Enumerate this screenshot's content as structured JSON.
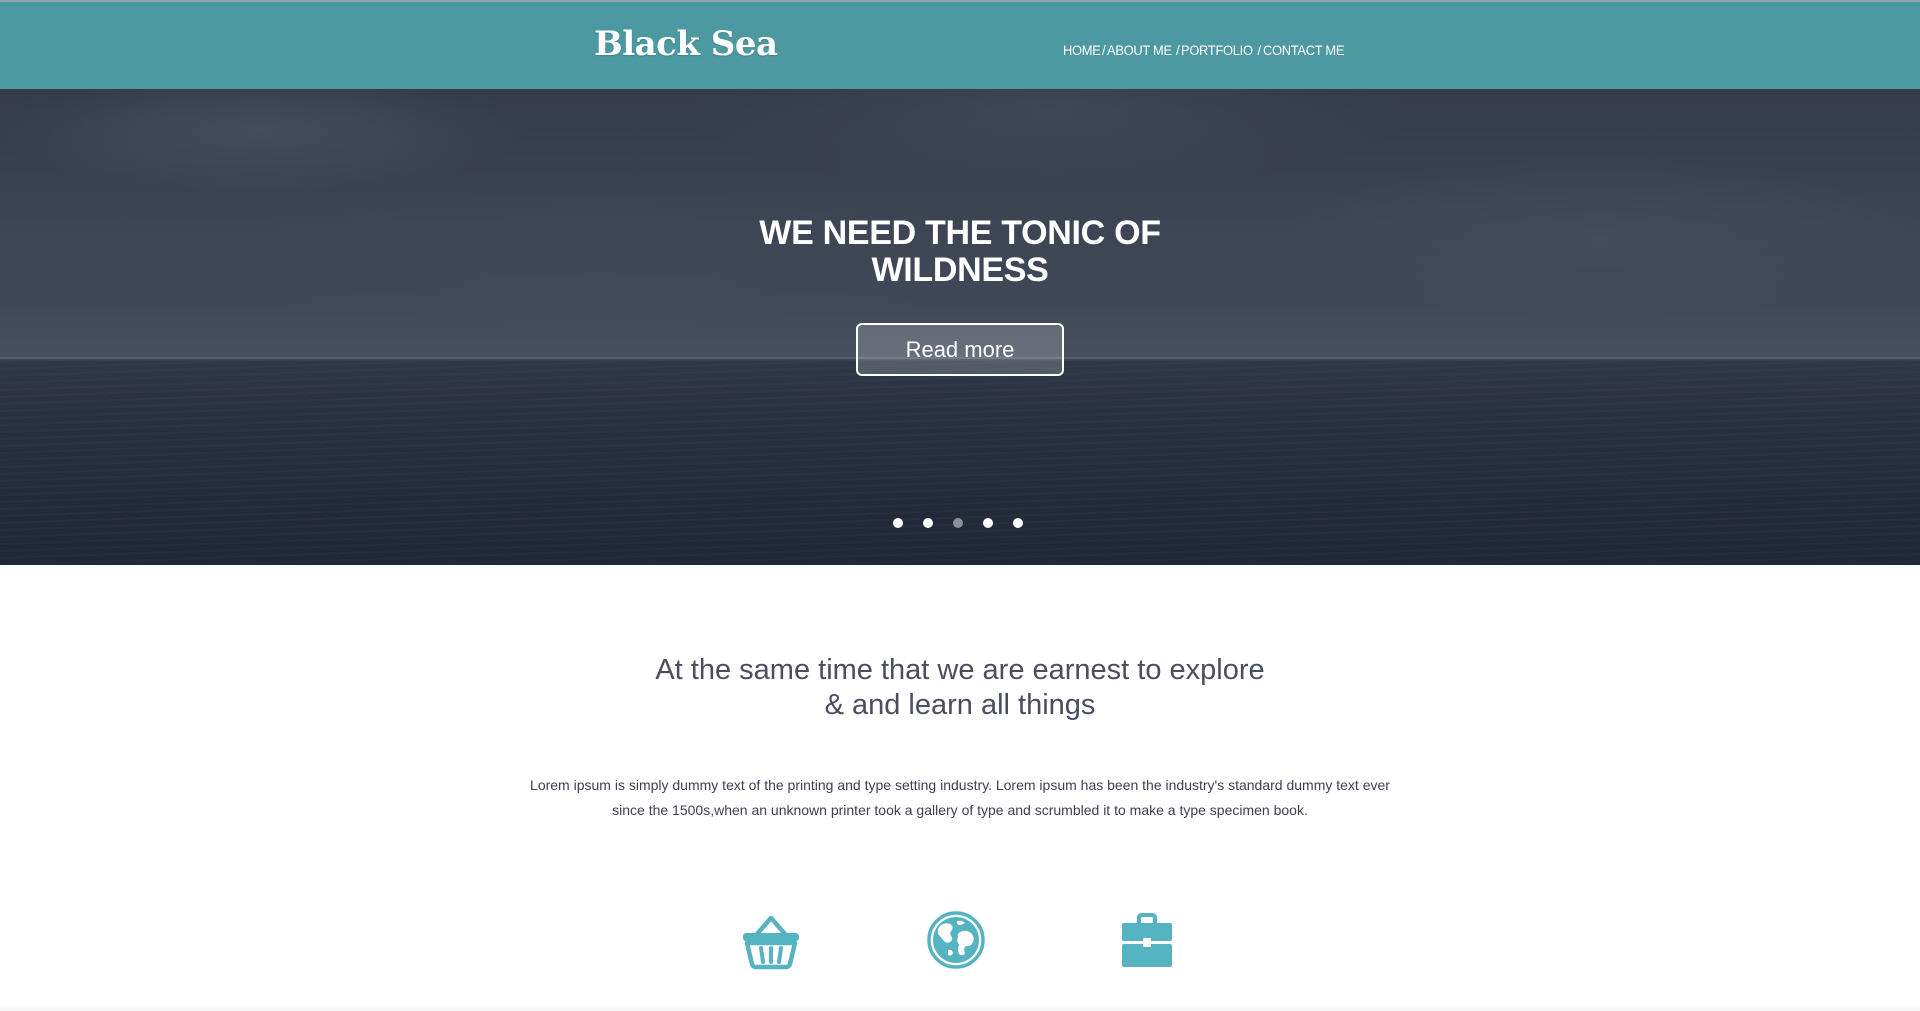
{
  "header": {
    "logo": "Black Sea",
    "nav": [
      {
        "label": "HOME"
      },
      {
        "label": "ABOUT ME"
      },
      {
        "label": "PORTFOLIO"
      },
      {
        "label": "CONTACT ME"
      }
    ],
    "nav_separator": "/",
    "background_color": "#4d99a1"
  },
  "hero": {
    "title_line1": "WE NEED THE TONIC OF",
    "title_line2": "WILDNESS",
    "button_label": "Read more",
    "slider_dots": 5,
    "active_dot": 3
  },
  "intro": {
    "heading_line1": "At the same time that we are earnest to explore",
    "heading_line2": "& and learn all things",
    "body_line1": "Lorem ipsum is simply dummy text of the printing and type setting industry. Lorem ipsum has been the industry's standard dummy text ever",
    "body_line2": "since the 1500s,when an unknown printer took a gallery of type and scrumbled it to make a type specimen book."
  },
  "features": [
    {
      "icon": "basket-icon"
    },
    {
      "icon": "globe-icon"
    },
    {
      "icon": "briefcase-icon"
    }
  ],
  "accent_color": "#55b3c2"
}
